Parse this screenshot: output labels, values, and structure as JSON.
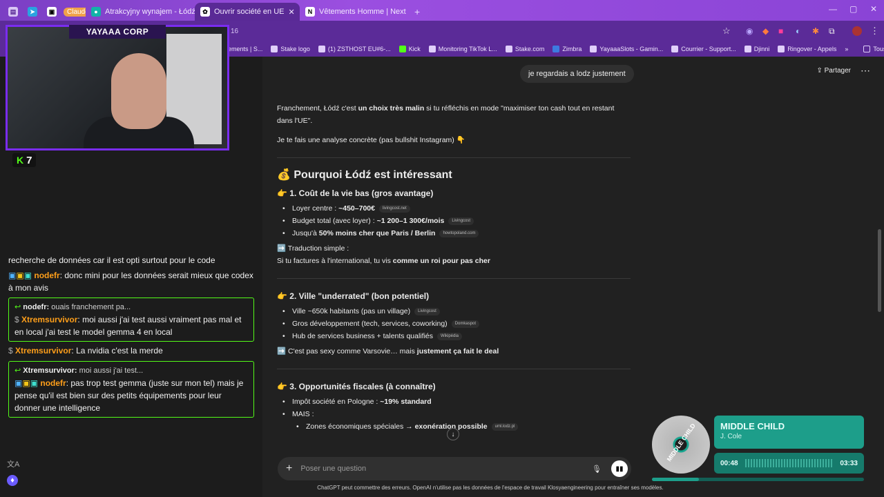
{
  "tabs": [
    {
      "label": "Claude",
      "icon": "claude-icon"
    },
    {
      "label": "Atrakcyjny wynajem - Łódź - sp",
      "icon": "site-icon"
    },
    {
      "label": "Ouvrir société en UE",
      "icon": "chatgpt-icon"
    },
    {
      "label": "Vêtements Homme | Next",
      "icon": "next-icon"
    }
  ],
  "bookmarks": [
    "ements | S...",
    "Stake logo",
    "(1) ZSTHOST EU#6-...",
    "Kick",
    "Monitoring TikTok L...",
    "Stake.com",
    "Zimbra",
    "YayaaaSlots - Gamin...",
    "Courrier - Support...",
    "Djinni",
    "Ringover - Appels"
  ],
  "bookmarks_all": "Tous les favoris",
  "overlay": {
    "banner": "YAYAAA CORP",
    "kick_count": "7",
    "toolbar_fragment": "16"
  },
  "chat": {
    "line1": "recherche de données car il est opti surtout pour le code",
    "msg1_user": "nodefr",
    "msg1_text": ": donc mini pour les données serait mieux que codex à mon avis",
    "reply1_to": "nodefr:",
    "reply1_quote": "ouais franchement pa...",
    "msg2_user": "Xtremsurvivor",
    "msg2_text": ": moi aussi j'ai test aussi vraiment pas mal et en local j'ai test le model gemma 4 en local",
    "msg3_user": "Xtremsurvivor",
    "msg3_text": ": La nvidia c'est la merde",
    "reply2_to": "Xtremsurvivor:",
    "reply2_quote": "moi aussi j'ai test...",
    "msg4_user": "nodefr",
    "msg4_text": ": pas trop test gemma (juste sur mon tel) mais je pense qu'il est bien sur des petits équipements pour leur donner une intelligence"
  },
  "main": {
    "share": "Partager",
    "user_message": "je regardais a lodz justement",
    "intro_a": "Franchement, Łódź c'est ",
    "intro_b": "un choix très malin",
    "intro_c": " si tu réfléchis en mode \"maximiser ton cash tout en restant dans l'UE\".",
    "intro2": "Je te fais une analyse concrète (pas bullshit Instagram) 👇",
    "h2": "💰 Pourquoi Łódź est intéressant",
    "s1_title": "👉 1. Coût de la vie bas (gros avantage)",
    "s1_items": [
      {
        "pre": "Loyer centre : ",
        "bold": "~450–700€",
        "post": "",
        "src": "livingcost.net"
      },
      {
        "pre": "Budget total (avec loyer) : ",
        "bold": "~1 200–1 300€/mois",
        "post": "",
        "src": "Livingcost"
      },
      {
        "pre": "Jusqu'à ",
        "bold": "50% moins cher que Paris / Berlin",
        "post": "",
        "src": "howtopoland.com"
      }
    ],
    "s1_note_a": "➡️ Traduction simple :",
    "s1_note_b": "Si tu factures à l'international, tu vis ",
    "s1_note_c": "comme un roi pour pas cher",
    "s2_title": "👉 2. Ville \"underrated\" (bon potentiel)",
    "s2_items": [
      {
        "pre": "Ville ~650k habitants (pas un village)",
        "bold": "",
        "post": "",
        "src": "Livingcost"
      },
      {
        "pre": "Gros développement (tech, services, coworking)",
        "bold": "",
        "post": "",
        "src": "Domkaspot"
      },
      {
        "pre": "Hub de services business + talents qualifiés",
        "bold": "",
        "post": "",
        "src": "Wikipédia"
      }
    ],
    "s2_note_a": "➡️ C'est pas sexy comme Varsovie… mais ",
    "s2_note_b": "justement ça fait le deal",
    "s3_title": "👉 3. Opportunités fiscales (à connaître)",
    "s3_item1_pre": "Impôt société en Pologne : ",
    "s3_item1_bold": "~19% standard",
    "s3_item2": "MAIS :",
    "s3_sub_pre": "Zones économiques spéciales → ",
    "s3_sub_bold": "exonération possible",
    "s3_sub_src": "uml.lodz.pl",
    "composer_placeholder": "Poser une question",
    "disclaimer": "ChatGPT peut commettre des erreurs. OpenAI n'utilise pas les données de l'espace de travail Klosyaengineering pour entraîner ses modèles."
  },
  "music": {
    "disc_label": "MIDDLE CHILD",
    "title": "MIDDLE CHILD",
    "artist": "J. Cole",
    "elapsed": "00:48",
    "duration": "03:33",
    "progress": 0.22
  }
}
